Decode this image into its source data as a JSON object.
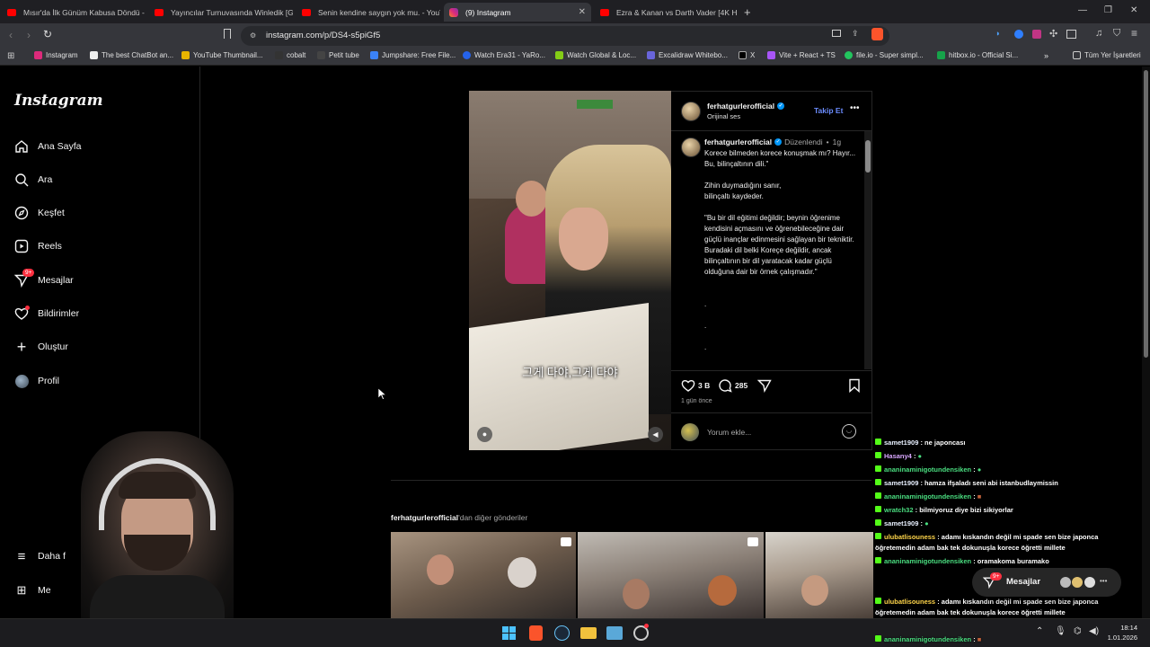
{
  "browser": {
    "tabs": [
      {
        "label": "Mısır'da İlk Günüm Kabusa Döndü - ",
        "icon": "youtube-icon"
      },
      {
        "label": "Yayıncılar Turnuvasında Winledik [Gh",
        "icon": "youtube-icon"
      },
      {
        "label": "Senin kendine saygın yok mu. - YouT",
        "icon": "youtube-icon"
      },
      {
        "label": "(9) Instagram",
        "icon": "instagram-icon"
      },
      {
        "label": "Ezra & Kanan vs Darth Vader [4K HDR",
        "icon": "youtube-icon"
      }
    ],
    "url": "instagram.com/p/DS4-s5piGf5",
    "bookmarks": [
      "Instagram",
      "The best ChatBot an...",
      "YouTube Thumbnail...",
      "cobalt",
      "Petit tube",
      "Jumpshare: Free File...",
      "Watch Era31 - YaRo...",
      "Watch Global & Loc...",
      "Excalidraw Whitebo...",
      "X",
      "Vite + React + TS",
      "file.io - Super simpl...",
      "hitbox.io - Official Si..."
    ],
    "bookmarks_folder": "Tüm Yer İşaretleri"
  },
  "instagram": {
    "logo": "Instagram",
    "nav": [
      "Ana Sayfa",
      "Ara",
      "Keşfet",
      "Reels",
      "Mesajlar",
      "Bildirimler",
      "Oluştur",
      "Profil"
    ],
    "messages_badge": "9+",
    "more": "Daha f",
    "meta": "Me"
  },
  "post": {
    "username": "ferhatgurlerofficial",
    "audio": "Orijinal ses",
    "follow": "Takip Et",
    "edited": "Düzenlendi",
    "age": "1g",
    "subtitle": "그게 다야,그게 다야",
    "caption": "Korece bilmeden korece konuşmak mı? Hayır... Bu, bilinçaltının dili.\"\n\nZihin duymadığını sanır,\nbilinçaltı kaydeder.\n\n\"Bu bir dil eğitimi değildir; beynin öğrenime kendisini açmasını ve öğrenebileceğine dair güçlü inançlar edinmesini sağlayan bir tekniktir. Buradaki dil belki Koreçe değildir, ancak bilinçaltının bir dil yaratacak kadar güçlü olduğuna dair bir örnek çalışmadır.\"",
    "dots": [
      ".",
      ".",
      "."
    ],
    "likes": "3 B",
    "comments": "285",
    "posted": "1 gün önce",
    "comment_placeholder": "Yorum ekle..."
  },
  "more_posts": {
    "user": "ferhatgurlerofficial",
    "suffix": "'dan diğer gönderiler"
  },
  "messages_float": {
    "label": "Mesajlar",
    "badge": "9+"
  },
  "chat": [
    {
      "user": "samet1909",
      "msg": ": ne japoncası"
    },
    {
      "user": "Hasany4",
      "msg": ":"
    },
    {
      "user": "ananinaminigotundensiken",
      "msg": ":"
    },
    {
      "user": "samet1909",
      "msg": ": hamza ifşaladı seni abi istanbudlaymissin"
    },
    {
      "user": "ananinaminigotundensiken",
      "msg": ":"
    },
    {
      "user": "wratch32",
      "msg": ": bilmiyoruz diye bizi sikiyorlar"
    },
    {
      "user": "samet1909",
      "msg": ":"
    },
    {
      "user": "ulubatlisouness",
      "msg": ": adamı kıskandın değil mi spade sen bize japonca"
    },
    {
      "user": "",
      "msg": "öğretemedin adam bak tek dokunuşla korece öğretti millete"
    },
    {
      "user": "ananinaminigotundensiken",
      "msg": ": oramakoma buramako"
    },
    {
      "user": "ulubatlisouness",
      "msg": ": adamı kıskandın değil mi spade sen bize japonca"
    },
    {
      "user": "",
      "msg": "öğretemedin adam bak tek dokunuşla korece öğretti millete"
    },
    {
      "user": "ananinaminigotundensiken",
      "msg": ":"
    },
    {
      "user": "ananinaminigotundensiken",
      "msg": ":"
    }
  ],
  "taskbar": {
    "time": "18:14",
    "date": "1.01.2026"
  },
  "colors": {
    "accent": "#0095f6",
    "follow": "#6b8cff",
    "badge": "#ff3040",
    "kick": "#53fc18"
  }
}
